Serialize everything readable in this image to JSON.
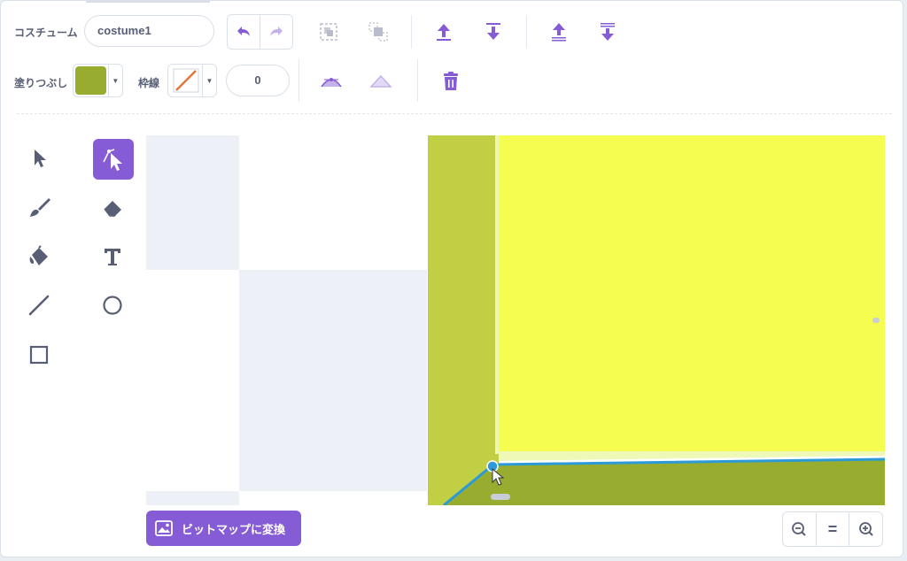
{
  "costume": {
    "label": "コスチューム",
    "name_value": "costume1"
  },
  "fill": {
    "label": "塗りつぶし",
    "color": "#98ad2f"
  },
  "outline": {
    "label": "枠線",
    "width_value": "0",
    "color_icon": "slash-none-icon"
  },
  "toolbar_icons": {
    "undo": "undo-icon",
    "redo": "redo-icon",
    "group": "group-icon",
    "ungroup": "ungroup-icon",
    "forward": "forward-icon",
    "backward": "backward-icon",
    "front": "front-icon",
    "back": "back-icon",
    "curved": "curved-point-icon",
    "pointed": "pointed-point-icon",
    "delete": "trash-icon"
  },
  "tools": [
    {
      "name": "select-tool",
      "icon": "arrow-icon",
      "active": false
    },
    {
      "name": "reshape-tool",
      "icon": "reshape-icon",
      "active": true
    },
    {
      "name": "brush-tool",
      "icon": "brush-icon",
      "active": false
    },
    {
      "name": "eraser-tool",
      "icon": "eraser-icon",
      "active": false
    },
    {
      "name": "fill-tool",
      "icon": "bucket-icon",
      "active": false
    },
    {
      "name": "text-tool",
      "icon": "text-icon",
      "active": false
    },
    {
      "name": "line-tool",
      "icon": "line-icon",
      "active": false
    },
    {
      "name": "circle-tool",
      "icon": "circle-icon",
      "active": false
    },
    {
      "name": "rectangle-tool",
      "icon": "rectangle-icon",
      "active": false
    }
  ],
  "colors": {
    "accent": "#855cd6",
    "olive": "#98ad2f",
    "lime": "#c0cf44",
    "yellow": "#f5fd51",
    "selection": "#2d9ad8"
  },
  "bottom": {
    "convert_label": "ビットマップに変換",
    "zoom_out": "zoom-out-icon",
    "zoom_reset": "=",
    "zoom_in": "zoom-in-icon"
  }
}
